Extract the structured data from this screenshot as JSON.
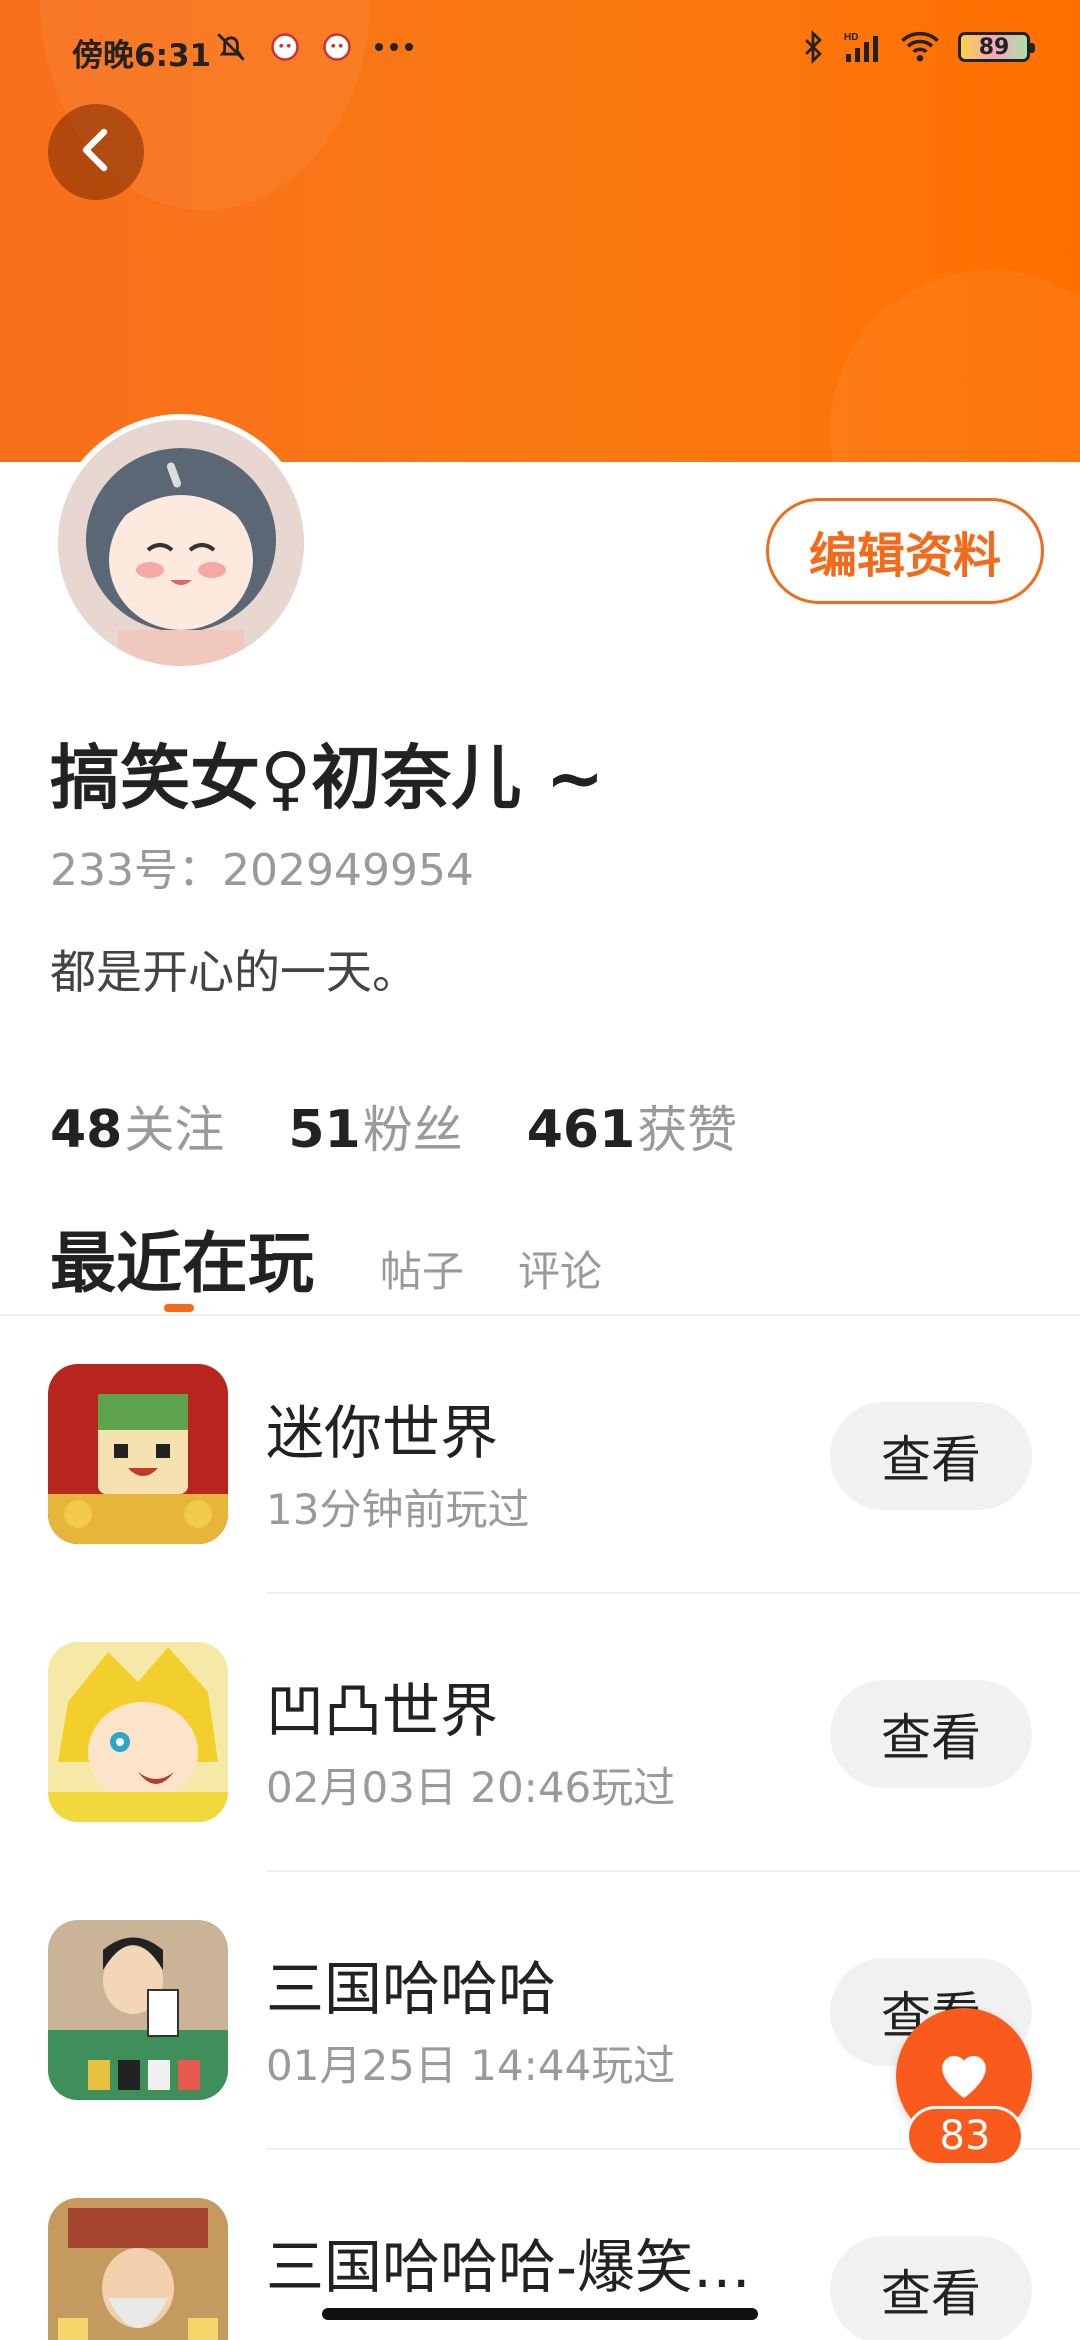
{
  "status_bar": {
    "time": "傍晚6:31",
    "battery": "89",
    "hd_label": "HD"
  },
  "profile": {
    "nickname": "搞笑女♀初奈儿 ~",
    "user_id": "233号：202949954",
    "bio": "都是开心的一天。",
    "edit_button": "编辑资料"
  },
  "stats": [
    {
      "num": "48",
      "label": "关注"
    },
    {
      "num": "51",
      "label": "粉丝"
    },
    {
      "num": "461",
      "label": "获赞"
    }
  ],
  "tabs": {
    "active": "最近在玩",
    "posts": "帖子",
    "comments": "评论"
  },
  "games": [
    {
      "title": "迷你世界",
      "time": "13分钟前玩过",
      "button": "查看"
    },
    {
      "title": "凹凸世界",
      "time": "02月03日 20:46玩过",
      "button": "查看"
    },
    {
      "title": "三国哈哈哈",
      "time": "01月25日 14:44玩过",
      "button": "查看"
    },
    {
      "title": "三国哈哈哈-爆笑…",
      "time": "",
      "button": "查看"
    }
  ],
  "like": {
    "count": "83"
  },
  "colors": {
    "accent": "#f36a1b",
    "banner": "#fa7a12"
  }
}
